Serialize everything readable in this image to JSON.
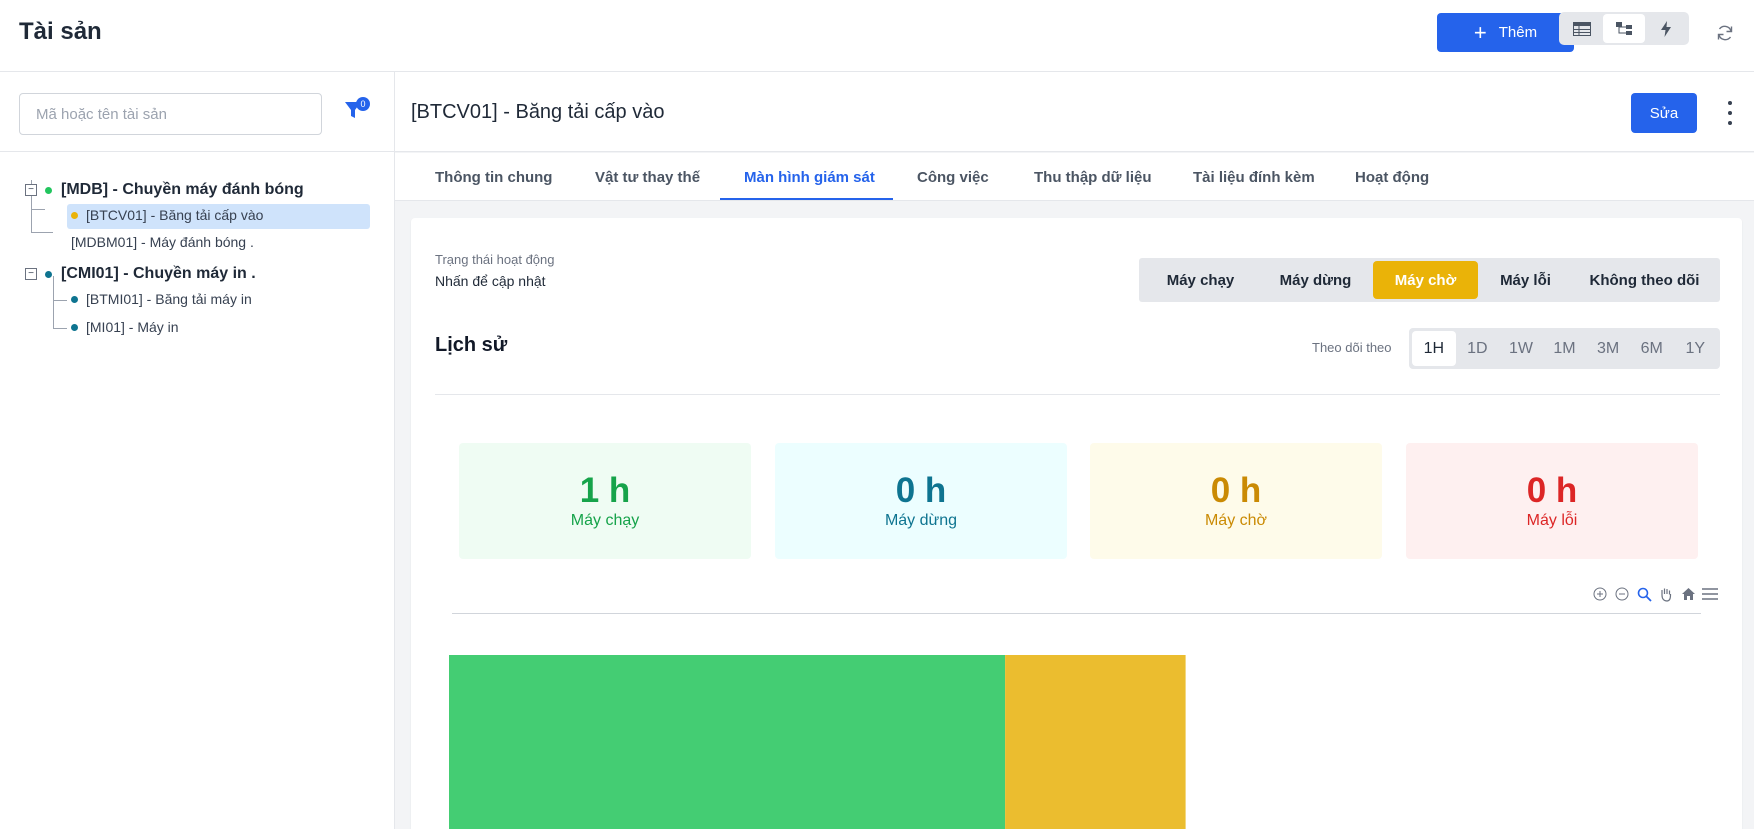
{
  "header": {
    "title": "Tài sản",
    "add_label": "Thêm"
  },
  "sidebar": {
    "search_placeholder": "Mã hoặc tên tài sản",
    "filter_count": "0",
    "tree": [
      {
        "label": "[MDB] - Chuyền máy đánh bóng",
        "status_color": "#22c55e",
        "children": [
          {
            "label": "[BTCV01] - Băng tải cấp vào",
            "status_color": "#eab308",
            "selected": true
          },
          {
            "label": "[MDBM01] - Máy đánh bóng .",
            "status_color": null
          }
        ]
      },
      {
        "label": "[CMI01] - Chuyền máy in .",
        "status_color": "#0e7490",
        "children": [
          {
            "label": "[BTMI01] - Băng tải máy in",
            "status_color": "#0e7490"
          },
          {
            "label": "[MI01] - Máy in",
            "status_color": "#0e7490"
          }
        ]
      }
    ]
  },
  "detail": {
    "title": "[BTCV01] - Băng tải cấp vào",
    "edit_label": "Sửa",
    "tabs": [
      "Thông tin chung",
      "Vật tư thay thế",
      "Màn hình giám sát",
      "Công việc",
      "Thu thập dữ liệu",
      "Tài liệu đính kèm",
      "Hoạt động"
    ],
    "active_tab": "Màn hình giám sát"
  },
  "monitor": {
    "status_label": "Trạng thái hoạt động",
    "status_hint": "Nhấn để cập nhật",
    "status_options": [
      "Máy chạy",
      "Máy dừng",
      "Máy chờ",
      "Máy lỗi",
      "Không theo dõi"
    ],
    "active_status": "Máy chờ",
    "history_title": "Lịch sử",
    "follow_label": "Theo dõi theo",
    "ranges": [
      "1H",
      "1D",
      "1W",
      "1M",
      "3M",
      "6M",
      "1Y"
    ],
    "active_range": "1H",
    "stats": [
      {
        "value": "1 h",
        "label": "Máy chạy",
        "color": "#16a34a",
        "bg": "#effcf3"
      },
      {
        "value": "0 h",
        "label": "Máy dừng",
        "color": "#0e7490",
        "bg": "#ecfeff"
      },
      {
        "value": "0 h",
        "label": "Máy chờ",
        "color": "#ca8a04",
        "bg": "#fefbea"
      },
      {
        "value": "0 h",
        "label": "Máy lỗi",
        "color": "#dc2626",
        "bg": "#fef0f0"
      }
    ],
    "chart_icons": [
      "zoom-in-icon",
      "zoom-out-icon",
      "magnifier-icon",
      "pan-hand-icon",
      "home-icon",
      "menu-icon"
    ]
  },
  "chart_data": {
    "type": "bar",
    "title": "",
    "xlabel": "",
    "ylabel": "",
    "series": [
      {
        "name": "Máy chạy",
        "color": "#44cd73",
        "share": 0.755
      },
      {
        "name": "Máy chờ",
        "color": "#ebbd2f",
        "share": 0.245
      }
    ],
    "visible_fraction_of_width": 0.58
  }
}
